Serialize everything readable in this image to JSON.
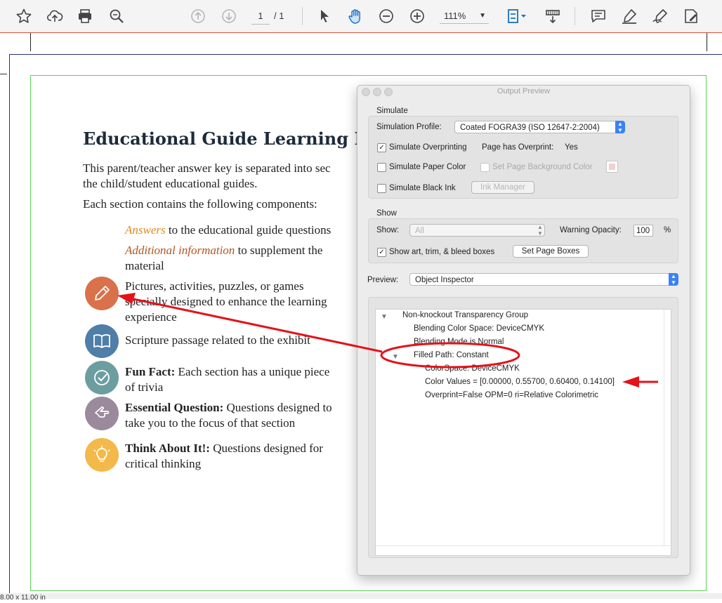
{
  "toolbar": {
    "page_current": "1",
    "page_total": "/ 1",
    "zoom": "111%",
    "icons": [
      "star-icon",
      "upload-icon",
      "print-icon",
      "zoom-search-icon",
      "prev-page-icon",
      "next-page-icon",
      "select-arrow-icon",
      "hand-icon",
      "zoom-out-icon",
      "zoom-in-icon",
      "page-fit-icon",
      "scroll-mode-icon",
      "comment-icon",
      "highlight-icon",
      "sign-icon",
      "fill-sign-icon"
    ]
  },
  "document": {
    "title": "Educational Guide Learning Points",
    "para1_line1": "This parent/teacher answer key is separated into sec",
    "para1_line2": "the child/student educational guides.",
    "para2": "Each section contains the following components:",
    "item1_em": "Answers",
    "item1_rest": " to the educational guide questions",
    "item2_em": "Additional information",
    "item2_rest_line1": " to supplement the",
    "item2_line2": "material",
    "item3_line1": "Pictures, activities, puzzles, or games",
    "item3_line2": "specially designed to enhance the learning",
    "item3_line3": "experience",
    "item4": "Scripture passage related to the exhibit",
    "item5_bold": "Fun Fact:",
    "item5_rest": " Each section has a unique piece",
    "item5_line2": "of trivia",
    "item6_bold": "Essential Question:",
    "item6_rest": " Questions designed to",
    "item6_line2": "take you to the focus of that section",
    "item7_bold": "Think About It!:",
    "item7_rest": " Questions designed for",
    "item7_line2": "critical thinking",
    "icon_colors": {
      "pencil": "#d9714a",
      "book": "#4f7ea8",
      "check": "#6c9ea0",
      "hand": "#9a8a9c",
      "bulb": "#f3b94a"
    }
  },
  "status_bar": {
    "text": "8.00 x 11.00 in"
  },
  "dialog": {
    "title": "Output Preview",
    "simulate_label": "Simulate",
    "simulation_profile_label": "Simulation Profile:",
    "simulation_profile_value": "Coated FOGRA39 (ISO 12647-2:2004)",
    "simulate_overprinting": "Simulate Overprinting",
    "simulate_overprinting_checked": true,
    "page_has_overprint_label": "Page has Overprint:",
    "page_has_overprint_value": "Yes",
    "simulate_paper_color": "Simulate Paper Color",
    "set_page_bg_color": "Set Page Background Color",
    "simulate_black_ink": "Simulate Black Ink",
    "ink_manager": "Ink Manager",
    "show_section_label": "Show",
    "show_label": "Show:",
    "show_value": "All",
    "warning_opacity_label": "Warning Opacity:",
    "warning_opacity_value": "100",
    "percent": "%",
    "show_art_trim": "Show art, trim, & bleed boxes",
    "show_art_trim_checked": true,
    "set_page_boxes": "Set Page Boxes",
    "preview_label": "Preview:",
    "preview_value": "Object Inspector",
    "tree": [
      {
        "text": "Non-knockout Transparency Group",
        "level": 0,
        "expanded": true
      },
      {
        "text": "Blending Color Space: DeviceCMYK",
        "level": 1
      },
      {
        "text": "Blending Mode is Normal",
        "level": 1
      },
      {
        "text": "Filled Path: Constant",
        "level": 1,
        "expanded": true
      },
      {
        "text": "ColorSpace: DeviceCMYK",
        "level": 2
      },
      {
        "text": "Color Values = [0.00000, 0.55700, 0.60400, 0.14100]",
        "level": 2
      },
      {
        "text": "Overprint=False OPM=0 ri=Relative Colorimetric",
        "level": 2
      }
    ],
    "colors": {
      "accent": "#3b82f6",
      "annotation_red": "#e3121b"
    }
  }
}
